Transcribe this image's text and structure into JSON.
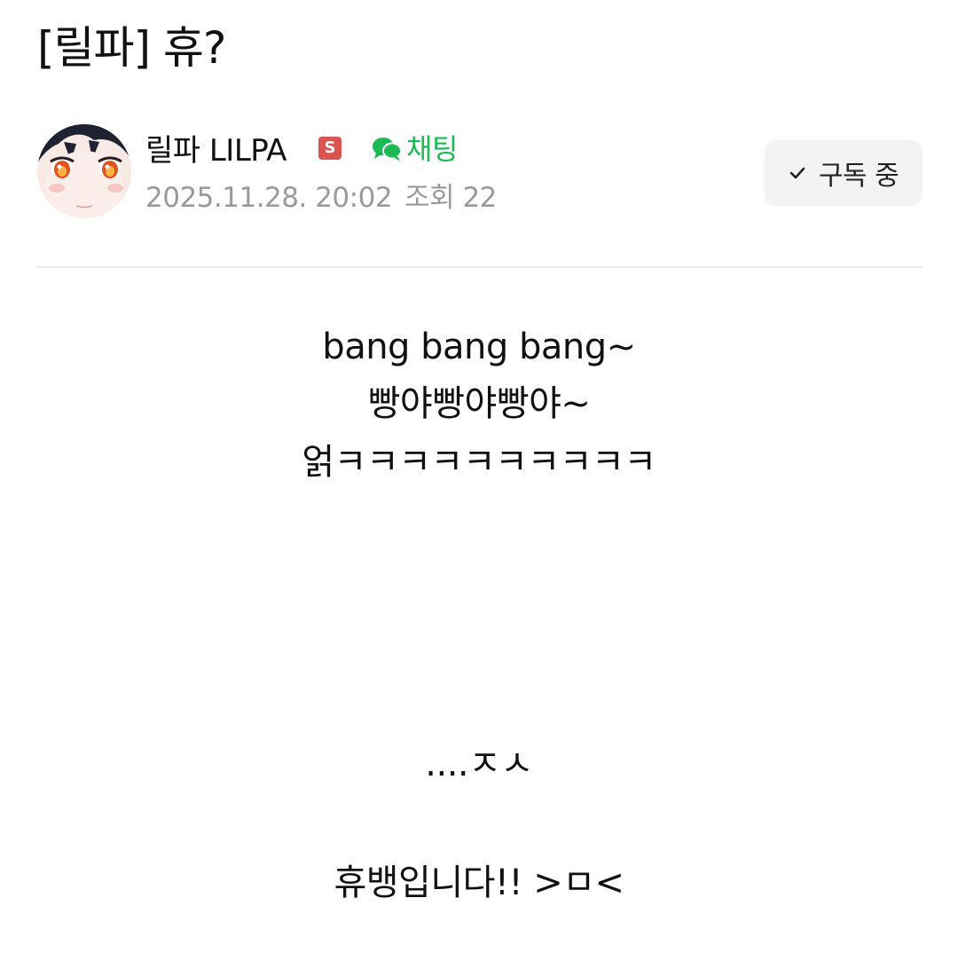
{
  "post": {
    "title": "[릴파] 휴?"
  },
  "author": {
    "name": "릴파 LILPA",
    "badge_letter": "S",
    "badge_color": "#d9534f",
    "chat_label": "채팅",
    "chat_color": "#1db954",
    "date": "2025.11.28. 20:02",
    "views": "조회 22"
  },
  "subscribe": {
    "label": "구독 중",
    "icon": "check-icon"
  },
  "content": {
    "lines": [
      "bang bang bang~",
      "빵야빵야빵야~",
      "얽ㅋㅋㅋㅋㅋㅋㅋㅋㅋㅋ",
      "....ㅈㅅ",
      "휴뱅입니다!! >ㅁ<"
    ]
  }
}
